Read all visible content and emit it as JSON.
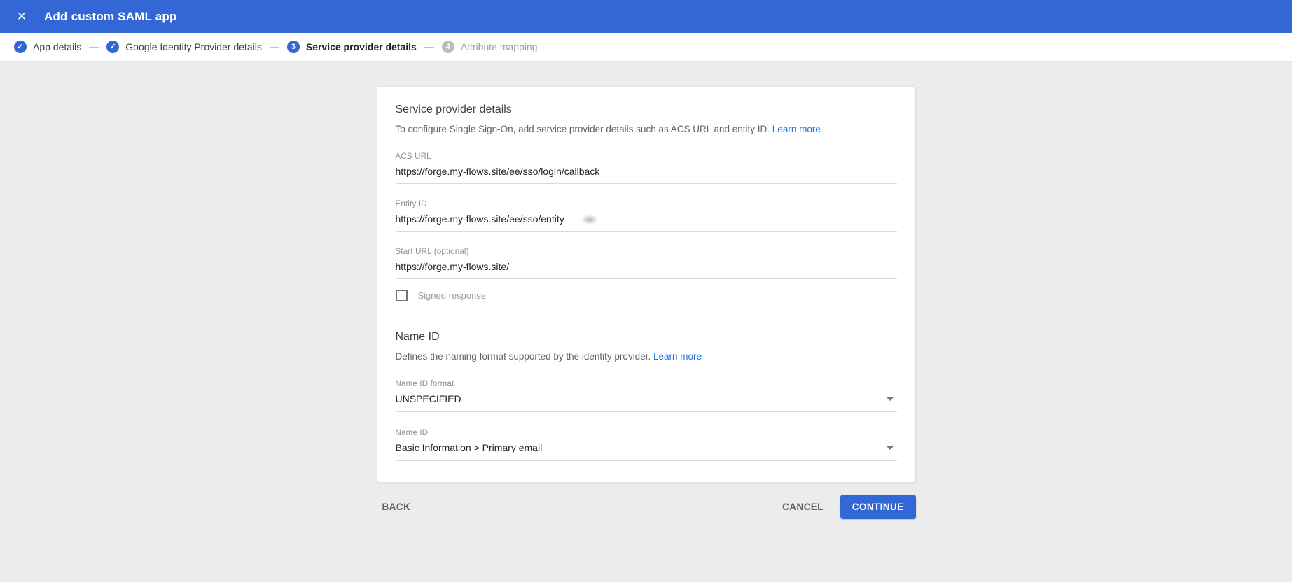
{
  "header": {
    "title": "Add custom SAML app",
    "close_icon": "✕"
  },
  "stepper": {
    "check_icon": "✓",
    "steps": [
      {
        "label": "App details",
        "state": "done"
      },
      {
        "label": "Google Identity Provider details",
        "state": "done"
      },
      {
        "label": "Service provider details",
        "state": "active",
        "number": "3"
      },
      {
        "label": "Attribute mapping",
        "state": "upcoming",
        "number": "4"
      }
    ]
  },
  "card": {
    "title": "Service provider details",
    "description": "To configure Single Sign-On, add service provider details such as ACS URL and entity ID.",
    "learn_more": "Learn more",
    "fields": [
      {
        "label": "ACS URL",
        "value": "https://forge.my-flows.site/ee/sso/login/callback"
      },
      {
        "label": "Entity ID",
        "value": "https://forge.my-flows.site/ee/sso/entity",
        "redacted": true
      },
      {
        "label": "Start URL (optional)",
        "value": "https://forge.my-flows.site/"
      }
    ],
    "signed_response": {
      "label": "Signed response",
      "checked": false
    },
    "name_id": {
      "title": "Name ID",
      "description": "Defines the naming format supported by the identity provider.",
      "learn_more": "Learn more",
      "selects": [
        {
          "label": "Name ID format",
          "value": "UNSPECIFIED"
        },
        {
          "label": "Name ID",
          "value": "Basic Information > Primary email"
        }
      ]
    }
  },
  "actions": {
    "back": "BACK",
    "cancel": "CANCEL",
    "continue": "CONTINUE"
  },
  "colors": {
    "accent": "#3367d6",
    "link": "#1a73e8"
  }
}
